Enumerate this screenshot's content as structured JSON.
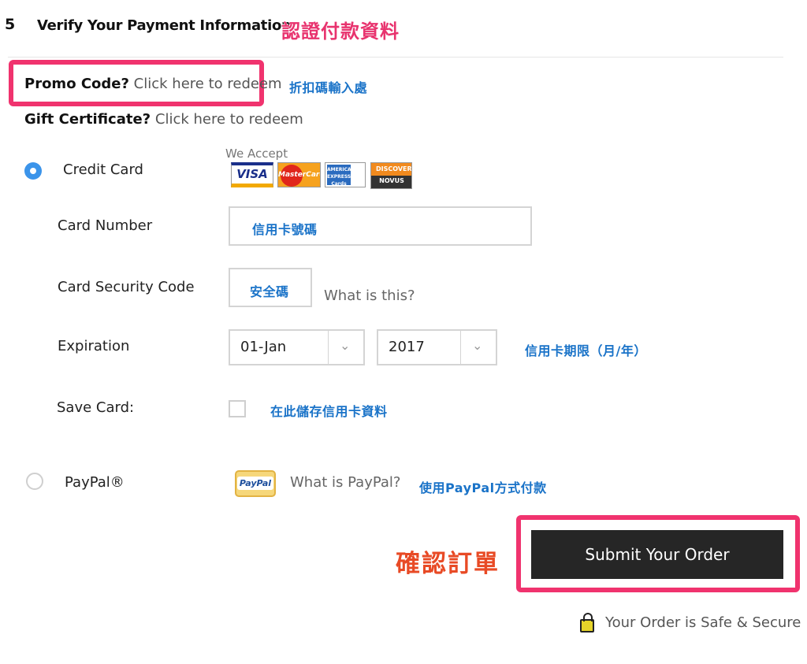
{
  "header": {
    "step_number": "5",
    "step_title": "Verify Your Payment Information",
    "annotation": "認證付款資料"
  },
  "promo": {
    "label": "Promo Code?",
    "link": "Click here to redeem",
    "annotation": "折扣碼輸入處"
  },
  "gift": {
    "label": "Gift Certificate?",
    "link": "Click here to redeem"
  },
  "payment": {
    "credit_card": {
      "label": "Credit Card",
      "selected": true,
      "we_accept_label": "We Accept",
      "cards": [
        "VISA",
        "MasterCard",
        "AMERICAN EXPRESS Cards",
        "DISCOVER NOVUS"
      ]
    },
    "card_number": {
      "label": "Card Number",
      "annotation": "信用卡號碼"
    },
    "security_code": {
      "label": "Card Security Code",
      "annotation": "安全碼",
      "help_link": "What is this?"
    },
    "expiration": {
      "label": "Expiration",
      "month_value": "01-Jan",
      "year_value": "2017",
      "annotation": "信用卡期限（月/年）"
    },
    "save_card": {
      "label": "Save Card:",
      "checked": false,
      "annotation": "在此儲存信用卡資料"
    },
    "paypal": {
      "label": "PayPal®",
      "selected": false,
      "badge_text": "PayPal",
      "help_link": "What is PayPal?",
      "annotation": "使用PayPal方式付款"
    }
  },
  "submit": {
    "label": "Submit Your Order",
    "annotation": "確認訂單"
  },
  "security_note": "Your Order is Safe & Secure",
  "colors": {
    "highlight_pink": "#f0336e",
    "annotation_blue": "#1a73c8",
    "annotation_red": "#e84a25",
    "radio_selected": "#3b94ea",
    "submit_bg": "#262626"
  }
}
